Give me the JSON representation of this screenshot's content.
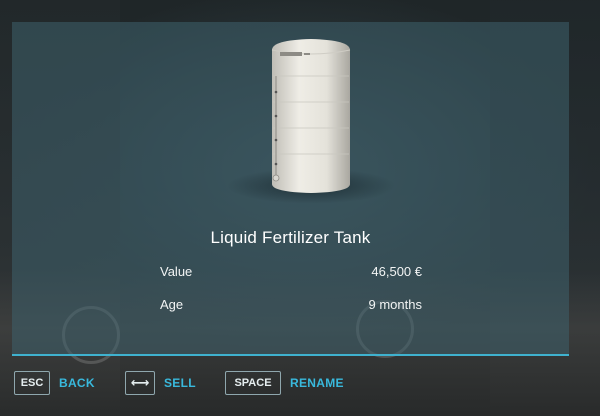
{
  "item": {
    "name": "Liquid Fertilizer Tank",
    "stats": [
      {
        "label": "Value",
        "value": "46,500 €"
      },
      {
        "label": "Age",
        "value": "9 months"
      }
    ]
  },
  "key_hints": {
    "back": {
      "key": "ESC",
      "label": "BACK"
    },
    "sell": {
      "key": "⟷",
      "label": "SELL"
    },
    "rename": {
      "key": "SPACE",
      "label": "RENAME"
    }
  },
  "colors": {
    "accent": "#39b9dd",
    "panel": "#3e606c",
    "text": "#ffffff"
  },
  "icons": {
    "sell_key": "horizontal-arrows-icon"
  }
}
